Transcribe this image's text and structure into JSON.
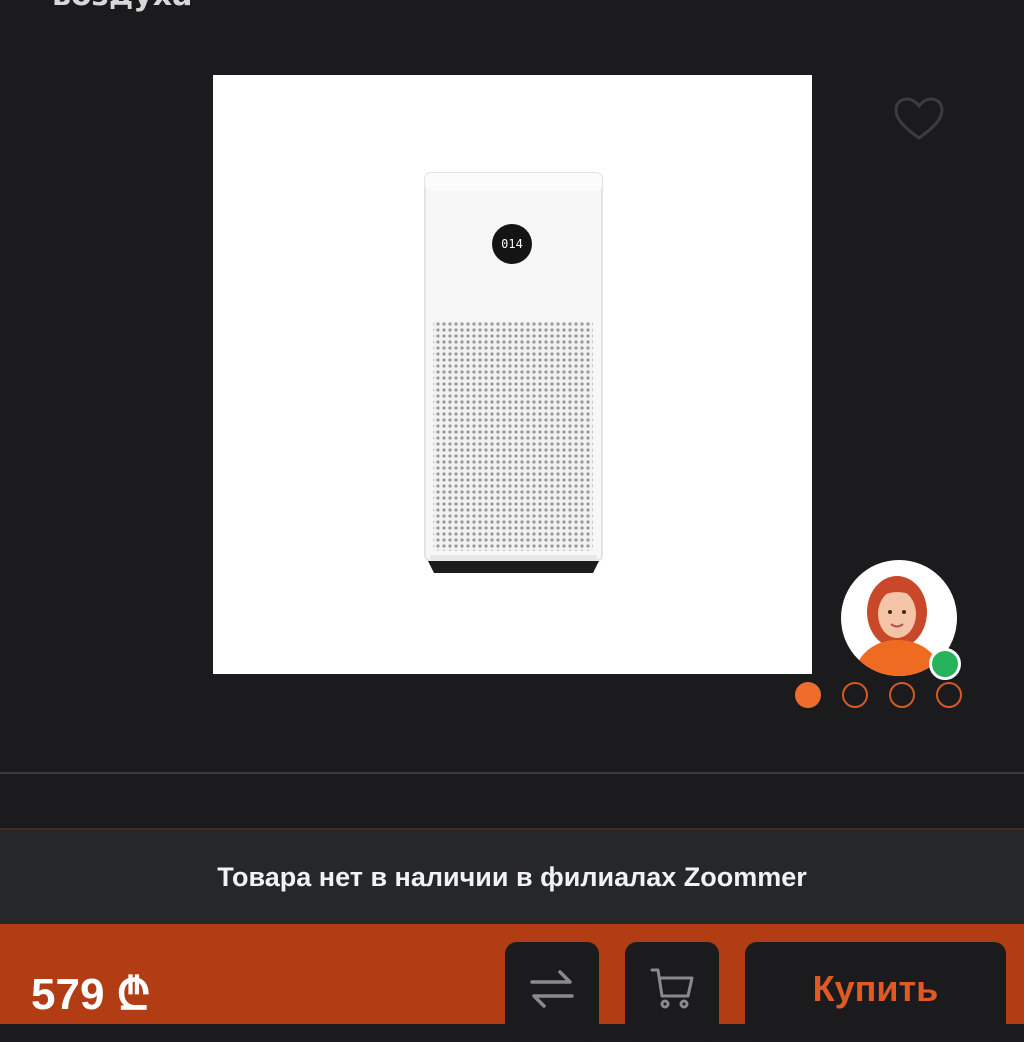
{
  "header": {
    "title_fragment": "воздуха"
  },
  "product": {
    "image_name": "air-purifier-photo",
    "display_text": "014",
    "gallery": {
      "total": 4,
      "active_index": 0
    },
    "favorite_icon": "heart-outline-icon"
  },
  "assistant": {
    "avatar": "support-agent-avatar",
    "status": "online",
    "status_color": "#26b35b"
  },
  "availability": {
    "message": "Товара нет в наличии в филиалах Zoommer"
  },
  "purchase": {
    "price": "579 ₾",
    "compare_icon": "compare-arrows-icon",
    "cart_icon": "add-to-cart-icon",
    "buy_label": "Купить"
  },
  "colors": {
    "accent": "#ee6c2c",
    "bottom_bar": "#b23c13",
    "background": "#1b1b1d"
  }
}
